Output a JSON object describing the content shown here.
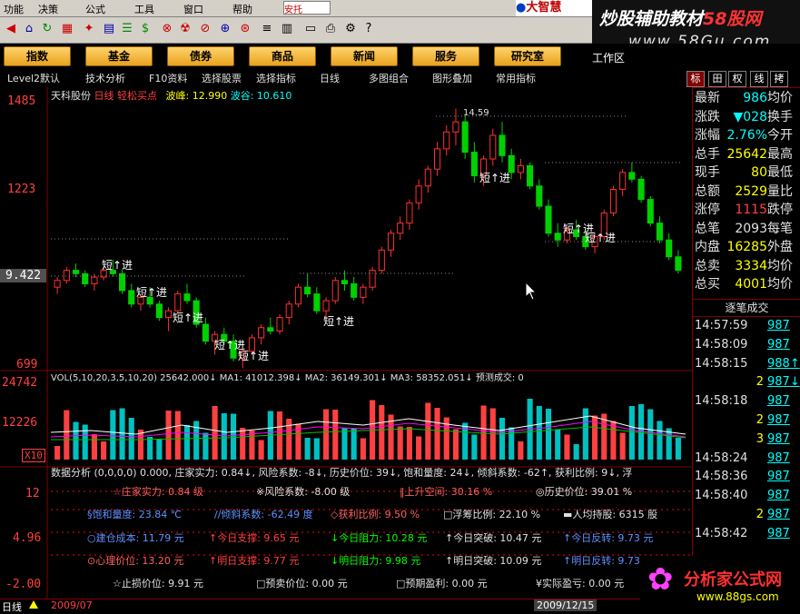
{
  "menu": {
    "items": [
      "功能",
      "决策",
      "公式",
      "工具",
      "窗口",
      "帮助"
    ],
    "brand": "大智慧",
    "input_value": "安托"
  },
  "watermark": {
    "line1_a": "炒股辅助教材",
    "line1_b": "58股网",
    "line2": "www.58Gu.com"
  },
  "nav": {
    "buttons": [
      "指数",
      "基金",
      "债券",
      "商品",
      "新闻",
      "服务",
      "研究室"
    ],
    "worktab": "工作区"
  },
  "toolrow": {
    "items": [
      "Level2默认",
      "技术分析",
      "F10资料",
      "选择股票",
      "选择指标",
      "日线",
      "多图组合",
      "图形叠加",
      "常用指标"
    ],
    "right_tabs": [
      "标",
      "田",
      "权",
      "线",
      "拷",
      "标"
    ]
  },
  "chart": {
    "stock_name": "天科股份",
    "period": "日线",
    "indicator": "轻松买点",
    "peak_label": "波峰: 12.990",
    "trough_label": "波谷: 10.610",
    "y_labels": [
      "1485",
      "1223",
      "9.422",
      "699"
    ],
    "peak_marker": "14.59",
    "signal_text": "短↑进",
    "vol_header": "VOL(5,10,20,3,5,10,20) 25642.000↓ MA1: 41012.398↓ MA2: 36149.301↓ MA3: 58352.051↓ 预测成交: 0",
    "vol_y_labels": [
      "24742",
      "12226",
      "X10"
    ],
    "analysis_header": "数据分析 (0,0,0,0) 0.000, 庄家实力: 0.84↓, 风险系数: -8↓, 历史价位: 39↓, 饱和量度: 24↓, 倾斜系数: -62↑, 获利比例: 9↓, 浮",
    "analysis_y_labels": [
      "12",
      "4.96",
      "-2.00"
    ]
  },
  "chart_data": {
    "type": "candlestick",
    "title": "天科股份 日线 轻松买点",
    "price_axis_labels": [
      14.85,
      12.23,
      9.422,
      6.99
    ],
    "markers": {
      "peak": 14.59,
      "wave_peak": 12.99,
      "wave_trough": 10.61
    },
    "ohlc": [
      [
        9.3,
        9.6,
        9.1,
        9.5
      ],
      [
        9.5,
        9.9,
        9.4,
        9.8
      ],
      [
        9.8,
        10.0,
        9.6,
        9.7
      ],
      [
        9.7,
        9.8,
        9.3,
        9.4
      ],
      [
        9.4,
        9.7,
        9.2,
        9.6
      ],
      [
        9.6,
        9.9,
        9.5,
        9.8
      ],
      [
        9.8,
        10.1,
        9.6,
        9.7
      ],
      [
        9.7,
        9.8,
        9.1,
        9.2
      ],
      [
        9.2,
        9.4,
        8.7,
        8.8
      ],
      [
        8.8,
        9.1,
        8.6,
        9.0
      ],
      [
        9.0,
        9.3,
        8.7,
        8.8
      ],
      [
        8.8,
        8.9,
        8.3,
        8.4
      ],
      [
        8.4,
        8.7,
        8.0,
        8.6
      ],
      [
        8.6,
        9.2,
        8.5,
        9.1
      ],
      [
        9.1,
        9.4,
        8.8,
        8.9
      ],
      [
        8.9,
        9.0,
        8.1,
        8.2
      ],
      [
        8.2,
        8.4,
        7.6,
        7.7
      ],
      [
        7.7,
        8.0,
        7.3,
        7.9
      ],
      [
        7.9,
        8.1,
        7.6,
        7.7
      ],
      [
        7.7,
        7.9,
        7.1,
        7.2
      ],
      [
        7.2,
        7.5,
        6.9,
        7.4
      ],
      [
        7.4,
        7.9,
        7.3,
        7.8
      ],
      [
        7.8,
        8.2,
        7.6,
        8.1
      ],
      [
        8.1,
        8.4,
        7.9,
        8.0
      ],
      [
        8.0,
        8.5,
        7.9,
        8.4
      ],
      [
        8.4,
        8.9,
        8.2,
        8.8
      ],
      [
        8.8,
        9.4,
        8.7,
        9.3
      ],
      [
        9.3,
        9.7,
        9.0,
        9.1
      ],
      [
        9.1,
        9.3,
        8.5,
        8.6
      ],
      [
        8.6,
        9.0,
        8.3,
        8.9
      ],
      [
        8.9,
        9.6,
        8.8,
        9.5
      ],
      [
        9.5,
        9.8,
        9.2,
        9.4
      ],
      [
        9.4,
        9.6,
        8.9,
        9.0
      ],
      [
        9.0,
        9.4,
        8.8,
        9.3
      ],
      [
        9.3,
        9.9,
        9.2,
        9.8
      ],
      [
        9.8,
        10.5,
        9.7,
        10.4
      ],
      [
        10.4,
        11.0,
        10.2,
        10.9
      ],
      [
        10.9,
        11.4,
        10.7,
        11.2
      ],
      [
        11.2,
        11.9,
        11.0,
        11.8
      ],
      [
        11.8,
        12.5,
        11.6,
        12.3
      ],
      [
        12.3,
        12.9,
        12.1,
        12.8
      ],
      [
        12.8,
        13.6,
        12.6,
        13.4
      ],
      [
        13.4,
        14.1,
        13.2,
        13.9
      ],
      [
        13.9,
        14.59,
        13.5,
        14.2
      ],
      [
        14.2,
        14.4,
        13.1,
        13.3
      ],
      [
        13.3,
        13.6,
        12.4,
        12.6
      ],
      [
        12.6,
        13.2,
        12.3,
        13.1
      ],
      [
        13.1,
        14.0,
        12.9,
        13.8
      ],
      [
        13.8,
        14.2,
        13.0,
        13.2
      ],
      [
        13.2,
        13.4,
        12.5,
        12.7
      ],
      [
        12.7,
        13.1,
        12.5,
        12.9
      ],
      [
        12.9,
        13.0,
        12.2,
        12.3
      ],
      [
        12.3,
        12.5,
        11.6,
        11.7
      ],
      [
        11.7,
        11.9,
        10.8,
        10.9
      ],
      [
        10.9,
        11.2,
        10.5,
        10.7
      ],
      [
        10.7,
        11.1,
        10.6,
        11.0
      ],
      [
        11.0,
        11.3,
        10.7,
        10.8
      ],
      [
        10.8,
        11.0,
        10.4,
        10.5
      ],
      [
        10.5,
        10.9,
        10.3,
        10.8
      ],
      [
        10.8,
        11.6,
        10.7,
        11.5
      ],
      [
        11.5,
        12.3,
        11.4,
        12.2
      ],
      [
        12.2,
        12.8,
        12.0,
        12.7
      ],
      [
        12.7,
        13.0,
        12.4,
        12.5
      ],
      [
        12.5,
        12.6,
        11.8,
        11.9
      ],
      [
        11.9,
        12.0,
        11.1,
        11.2
      ],
      [
        11.2,
        11.4,
        10.6,
        10.7
      ],
      [
        10.7,
        10.9,
        10.1,
        10.2
      ],
      [
        10.2,
        10.4,
        9.7,
        9.8
      ]
    ],
    "volume_axis_labels": [
      24742,
      12226
    ],
    "analysis_axis_labels": [
      12,
      4.96,
      -2.0
    ]
  },
  "info": {
    "r1": [
      "☆庄家实力: 0.84 级",
      "※风险系数: -8.00 级",
      "‖上升空间: 30.16 %",
      "◎历史价位: 39.01 %"
    ],
    "r2": [
      "§饱和量度: 23.84 ℃",
      "//倾斜系数: -62.49 度",
      "◇获利比例: 9.50 %",
      "□浮筹比例: 22.10 %",
      "▬人均持股: 6315 股"
    ],
    "r3": [
      "○建仓成本: 11.79 元",
      "↑今日支撑: 9.65 元",
      "↓今日阻力: 10.28 元",
      "↑今日突破: 10.47 元",
      "↑今日反转: 9.73 元"
    ],
    "r4": [
      "⊙心理价位: 13.20 元",
      "↑明日支撑: 9.77 元",
      "↓明日阻力: 9.98 元",
      "↑明日突破: 10.09 元",
      "↑明日反转: 9.73 元"
    ],
    "r5": [
      "☆止损价位: 9.91 元",
      "□预卖价位: 0.00 元",
      "□预期盈利: 0.00 元",
      "¥实际盈亏: 0.00 元"
    ]
  },
  "quote": {
    "rows": [
      {
        "l": "最新",
        "v": "986",
        "r": "均价"
      },
      {
        "l": "涨跌",
        "v": "▼028",
        "r": "换手"
      },
      {
        "l": "涨幅",
        "v": "2.76%",
        "r": "今开"
      },
      {
        "l": "总手",
        "v": "25642",
        "r": "最高"
      },
      {
        "l": "现手",
        "v": "80",
        "r": "最低"
      },
      {
        "l": "总额",
        "v": "2529",
        "r": "量比"
      },
      {
        "l": "涨停",
        "v": "1115",
        "r": "跌停"
      },
      {
        "l": "总笔",
        "v": "2093",
        "r": "每笔"
      },
      {
        "l": "内盘",
        "v": "16285",
        "r": "外盘"
      },
      {
        "l": "总卖",
        "v": "3334",
        "r": "均价"
      },
      {
        "l": "总买",
        "v": "4001",
        "r": "均价"
      }
    ],
    "trades_title": "逐笔成交",
    "trades": [
      {
        "t": "14:57:59",
        "p": "987"
      },
      {
        "t": "14:58:09",
        "p": "987"
      },
      {
        "t": "14:58:15",
        "p": "988↑"
      },
      {
        "t": "2",
        "p": "987↓"
      },
      {
        "t": "14:58:18",
        "p": "987"
      },
      {
        "t": "2",
        "p": "987"
      },
      {
        "t": "3",
        "p": "987"
      },
      {
        "t": "14:58:24",
        "p": "987"
      },
      {
        "t": "14:58:36",
        "p": "987"
      },
      {
        "t": "14:58:40",
        "p": "987"
      },
      {
        "t": "2",
        "p": "987"
      },
      {
        "t": "14:58:42",
        "p": "987"
      }
    ]
  },
  "bottom": {
    "period": "日线",
    "date_left": "2009/07",
    "date_right": "2009/12/15"
  },
  "logo": {
    "text": "分析家公式网",
    "url": "www.88gs.com"
  }
}
